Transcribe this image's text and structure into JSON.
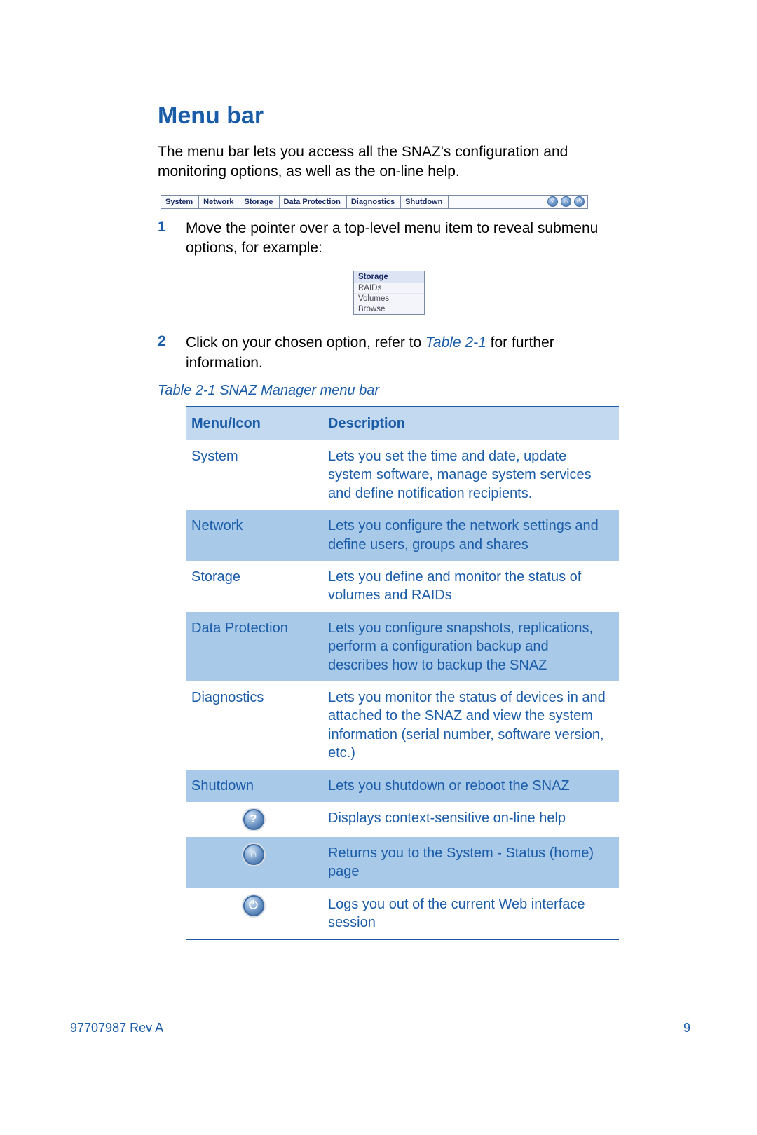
{
  "heading": "Menu bar",
  "intro": "The menu bar lets you access all the SNAZ's configuration and monitoring options, as well as the on-line help.",
  "menubar": {
    "items": [
      "System",
      "Network",
      "Storage",
      "Data Protection",
      "Diagnostics",
      "Shutdown"
    ],
    "icons": [
      "?",
      "⌂",
      "⏻"
    ]
  },
  "steps": [
    {
      "num": "1",
      "text": "Move the pointer over a top-level menu item to reveal submenu options, for example:"
    },
    {
      "num": "2",
      "text_before": "Click on your chosen option, refer to ",
      "link": "Table 2-1",
      "text_after": " for further information."
    }
  ],
  "submenu": {
    "head": "Storage",
    "items": [
      "RAIDs",
      "Volumes",
      "Browse"
    ]
  },
  "caption": "Table 2-1 SNAZ Manager menu bar",
  "table": {
    "headers": [
      "Menu/Icon",
      "Description"
    ],
    "rows": [
      {
        "alt": false,
        "menu": "System",
        "desc": "Lets you set the time and date, update system software, manage system services and define notification recipients."
      },
      {
        "alt": true,
        "menu": "Network",
        "desc": "Lets you configure the network settings and define users, groups and shares"
      },
      {
        "alt": false,
        "menu": "Storage",
        "desc": "Lets you define and monitor the status of volumes and RAIDs"
      },
      {
        "alt": true,
        "menu": "Data Protection",
        "desc": "Lets you configure snapshots, replications, perform a configuration backup and describes how to backup the SNAZ"
      },
      {
        "alt": false,
        "menu": "Diagnostics",
        "desc": "Lets you monitor the status of devices in and attached to the SNAZ and view the system information (serial number, software version, etc.)"
      },
      {
        "alt": true,
        "menu": "Shutdown",
        "desc": "Lets you shutdown or reboot the SNAZ"
      },
      {
        "alt": false,
        "icon": "help",
        "glyph": "?",
        "desc": "Displays context-sensitive on-line help"
      },
      {
        "alt": true,
        "icon": "home",
        "glyph": "⌂",
        "desc": "Returns you to the System - Status (home) page"
      },
      {
        "alt": false,
        "icon": "logout",
        "glyph": "⏻",
        "desc": "Logs you out of the current Web interface session"
      }
    ]
  },
  "footer": {
    "left": "97707987 Rev A",
    "right": "9"
  }
}
